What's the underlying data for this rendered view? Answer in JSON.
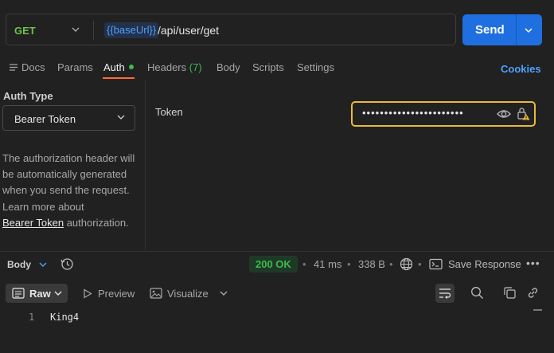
{
  "request": {
    "method": "GET",
    "url_variable": "{{baseUrl}}",
    "url_path": " /api/user/get",
    "send_label": "Send"
  },
  "tabs": {
    "docs": "Docs",
    "params": "Params",
    "auth": "Auth",
    "headers": "Headers",
    "headers_count": "(7)",
    "body": "Body",
    "scripts": "Scripts",
    "settings": "Settings",
    "cookies": "Cookies"
  },
  "auth": {
    "type_label": "Auth Type",
    "type_value": "Bearer Token",
    "description": "The authorization header will be automatically generated when you send the request.",
    "learn_more": "Learn more about",
    "link_text": "Bearer Token",
    "link_suffix": " authorization.",
    "token_label": "Token",
    "token_masked": "•••••••••••••••••••••••"
  },
  "response": {
    "body_label": "Body",
    "status": "200 OK",
    "time": "41 ms",
    "size": "338 B",
    "save_label": "Save Response",
    "views": {
      "raw": "Raw",
      "preview": "Preview",
      "visualize": "Visualize"
    },
    "lines": [
      {
        "num": "1",
        "text": "King4"
      }
    ]
  },
  "colors": {
    "accent": "#ff6c37",
    "send": "#1f6fe0",
    "success": "#3fb950",
    "link": "#4fa0ff",
    "focus": "#e8b93b"
  }
}
